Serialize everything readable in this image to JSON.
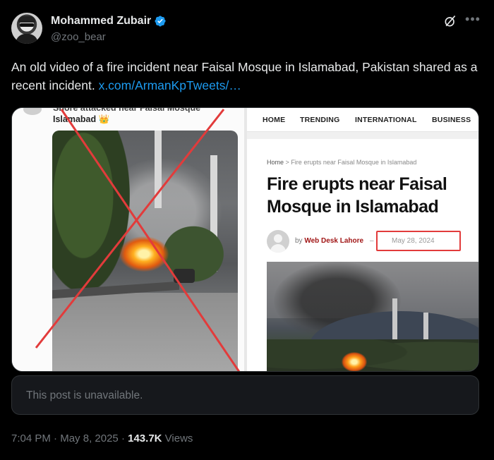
{
  "author": {
    "display_name": "Mohammed Zubair",
    "handle": "@zoo_bear",
    "verified": true,
    "verified_color": "#1d9bf0"
  },
  "post": {
    "text": "An old video of a fire incident near Faisal Mosque in Islamabad, Pakistan shared as a recent incident.",
    "link_text": "x.com/ArmanKpTweets/…",
    "link_color": "#1d9bf0"
  },
  "media": {
    "left_image": {
      "caption_cut": "Shore attacked near Faisal Mosque",
      "caption_city": "Islamabad 👑",
      "crossed_out": true,
      "cross_color": "#e23b3b"
    },
    "right_image": {
      "nav": [
        "HOME",
        "TRENDING",
        "INTERNATIONAL",
        "BUSINESS"
      ],
      "breadcrumb_home": "Home",
      "breadcrumb_separator": ">",
      "breadcrumb_current": "Fire erupts near Faisal Mosque in Islamabad",
      "headline": "Fire erupts near Faisal Mosque in Islamabad",
      "byline_prefix": "by",
      "byline_author": "Web Desk Lahore",
      "byline_dash": "–",
      "date": "May 28, 2024",
      "date_highlight_color": "#e23b3b"
    }
  },
  "quoted_post": {
    "text": "This post is unavailable."
  },
  "meta": {
    "time": "7:04 PM",
    "separator": "·",
    "date": "May 8, 2025",
    "views_count": "143.7K",
    "views_label": "Views"
  },
  "icons": {
    "grok": "grok-icon",
    "more": "more-icon",
    "verified": "verified-badge-icon"
  }
}
